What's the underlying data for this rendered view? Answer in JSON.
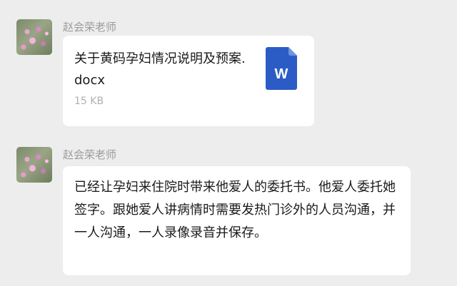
{
  "messages": [
    {
      "sender": "赵会荣老师",
      "type": "file",
      "file_name": "关于黄码孕妇情况说明及预案.docx",
      "file_size": "15 KB",
      "file_icon": "word-doc-icon",
      "file_icon_letter": "W",
      "file_icon_color": "#2b5cc6"
    },
    {
      "sender": "赵会荣老师",
      "type": "text",
      "text": "已经让孕妇来住院时带来他爱人的委托书。他爱人委托她签字。跟她爱人讲病情时需要发热门诊外的人员沟通，并一人沟通，一人录像录音并保存。"
    }
  ]
}
